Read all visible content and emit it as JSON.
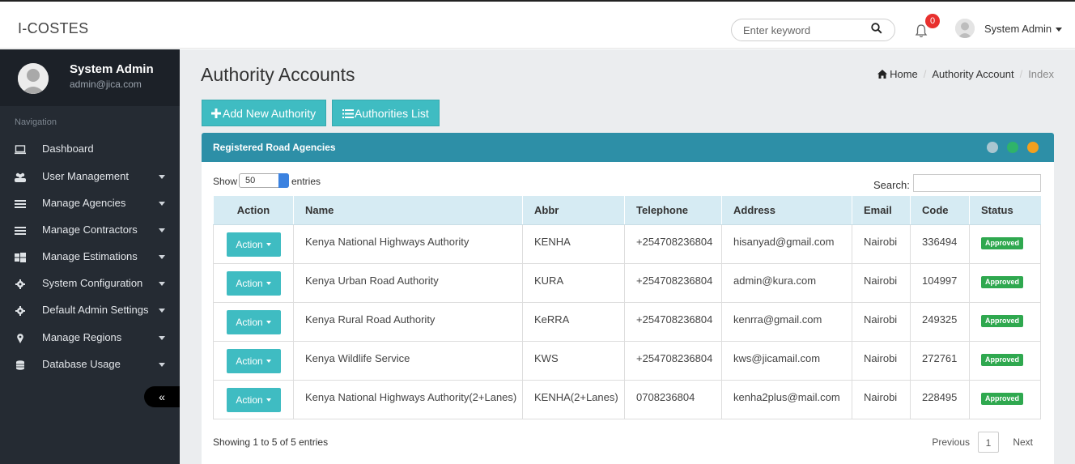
{
  "app": {
    "title": "I-COSTES"
  },
  "header": {
    "search_placeholder": "Enter keyword",
    "notifications_count": "0",
    "user_name": "System Admin"
  },
  "sidebar": {
    "profile": {
      "name": "System Admin",
      "email": "admin@jica.com"
    },
    "nav_heading": "Navigation",
    "items": [
      {
        "label": "Dashboard",
        "icon": "monitor-icon",
        "has_caret": false
      },
      {
        "label": "User Management",
        "icon": "users-icon",
        "has_caret": true
      },
      {
        "label": "Manage Agencies",
        "icon": "list-icon",
        "has_caret": true
      },
      {
        "label": "Manage Contractors",
        "icon": "list-icon",
        "has_caret": true
      },
      {
        "label": "Manage Estimations",
        "icon": "windows-icon",
        "has_caret": true
      },
      {
        "label": "System Configuration",
        "icon": "gear-icon",
        "has_caret": true
      },
      {
        "label": "Default Admin Settings",
        "icon": "gear-icon",
        "has_caret": true
      },
      {
        "label": "Manage Regions",
        "icon": "map-marker-icon",
        "has_caret": true
      },
      {
        "label": "Database Usage",
        "icon": "database-icon",
        "has_caret": true
      }
    ],
    "collapse_label": "«"
  },
  "page": {
    "title": "Authority Accounts",
    "breadcrumb": [
      "Home",
      "Authority Account",
      "Index"
    ],
    "buttons": {
      "add": "Add New Authority",
      "list": "Authorities List"
    }
  },
  "panel": {
    "title": "Registered Road Agencies",
    "show_label": "Show",
    "page_size": "50",
    "entries_label": "entries",
    "search_label": "Search:",
    "columns": [
      "Action",
      "Name",
      "Abbr",
      "Telephone",
      "Address",
      "Email",
      "Code",
      "Status"
    ],
    "rows": [
      {
        "action": "Action",
        "name": "Kenya National Highways Authority",
        "abbr": "KENHA",
        "telephone": "+254708236804",
        "address": "hisanyad@gmail.com",
        "email": "Nairobi",
        "code": "336494",
        "status": "Approved"
      },
      {
        "action": "Action",
        "name": "Kenya Urban Road Authority",
        "abbr": "KURA",
        "telephone": "+254708236804",
        "address": "admin@kura.com",
        "email": "Nairobi",
        "code": "104997",
        "status": "Approved"
      },
      {
        "action": "Action",
        "name": "Kenya Rural Road Authority",
        "abbr": "KeRRA",
        "telephone": "+254708236804",
        "address": "kenrra@gmail.com",
        "email": "Nairobi",
        "code": "249325",
        "status": "Approved"
      },
      {
        "action": "Action",
        "name": "Kenya Wildlife Service",
        "abbr": "KWS",
        "telephone": "+254708236804",
        "address": "kws@jicamail.com",
        "email": "Nairobi",
        "code": "272761",
        "status": "Approved"
      },
      {
        "action": "Action",
        "name": "Kenya National Highways Authority(2+Lanes)",
        "abbr": "KENHA(2+Lanes)",
        "telephone": "0708236804",
        "address": "kenha2plus@mail.com",
        "email": "Nairobi",
        "code": "228495",
        "status": "Approved"
      }
    ],
    "info": "Showing 1 to 5 of 5 entries",
    "pagination": {
      "previous": "Previous",
      "current": "1",
      "next": "Next"
    }
  },
  "colors": {
    "sidebar_bg": "#252b33",
    "accent": "#3fbcc2",
    "panel_header": "#2d8fa7",
    "status_approved": "#2fa84f",
    "notification_badge": "#e8302e"
  }
}
